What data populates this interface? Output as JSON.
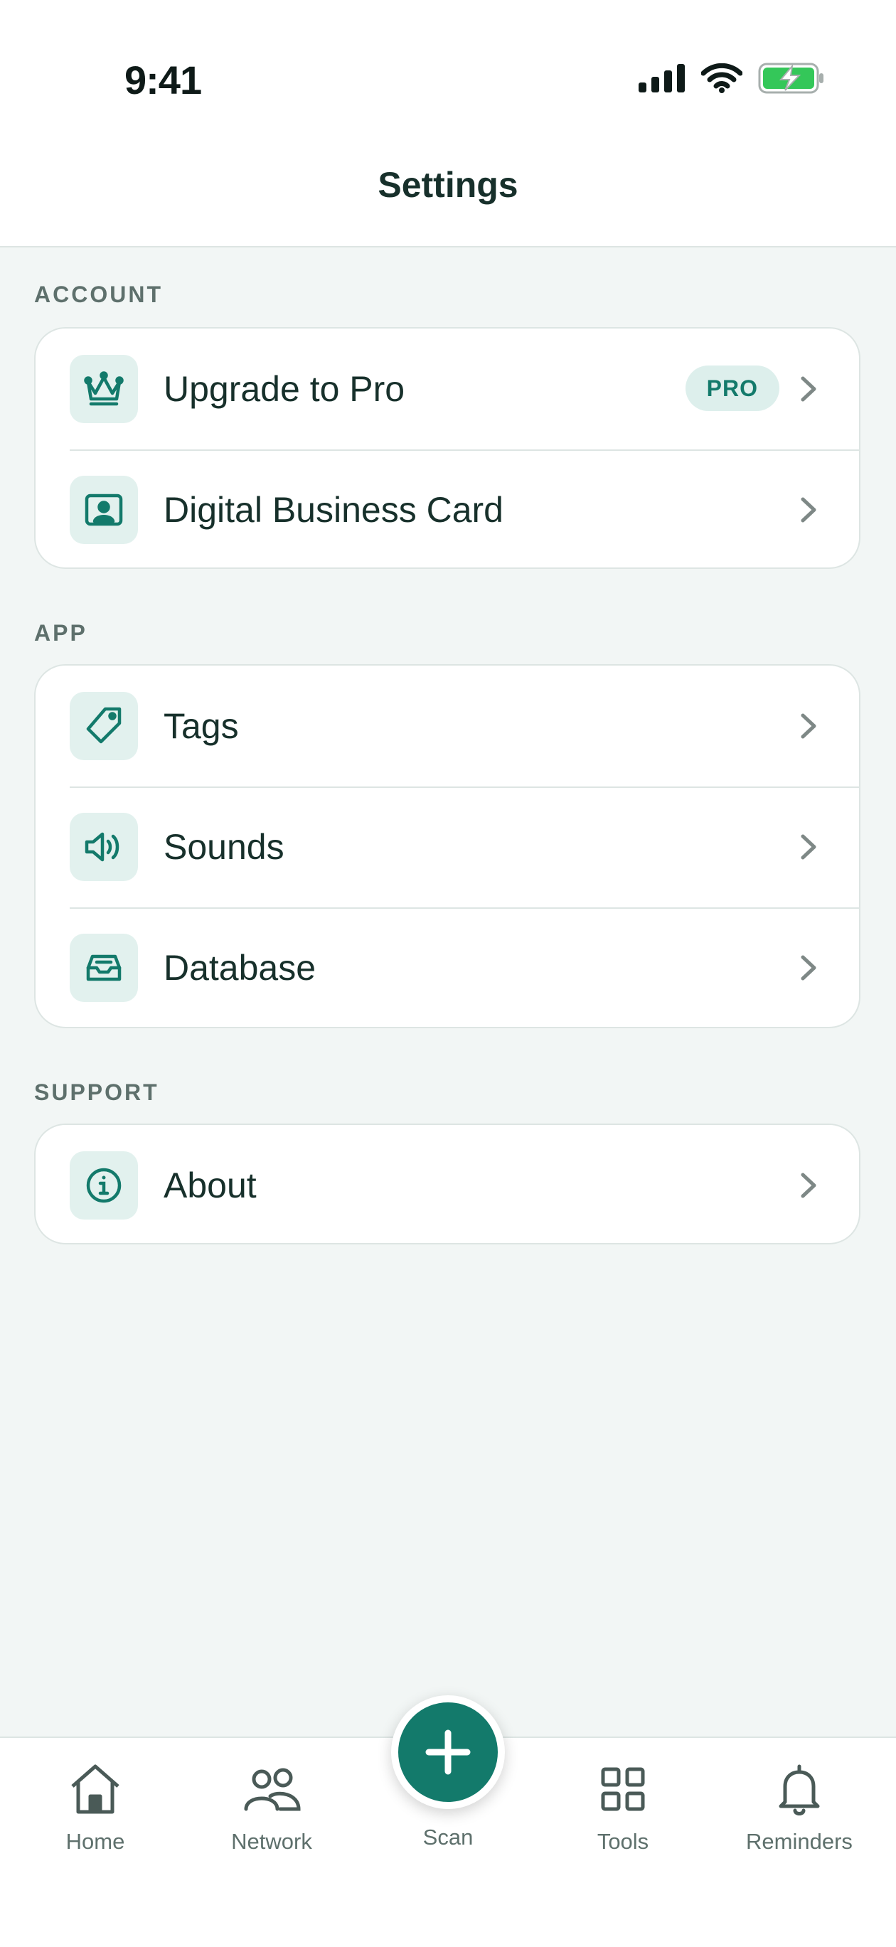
{
  "status": {
    "time": "9:41"
  },
  "header": {
    "title": "Settings"
  },
  "sections": {
    "account": {
      "title": "ACCOUNT",
      "items": [
        {
          "label": "Upgrade to Pro",
          "badge": "PRO",
          "icon": "crown-icon"
        },
        {
          "label": "Digital Business Card",
          "icon": "contact-card-icon"
        }
      ]
    },
    "app": {
      "title": "APP",
      "items": [
        {
          "label": "Tags",
          "icon": "tag-icon"
        },
        {
          "label": "Sounds",
          "icon": "speaker-icon"
        },
        {
          "label": "Database",
          "icon": "inbox-tray-icon"
        }
      ]
    },
    "support": {
      "title": "SUPPORT",
      "items": [
        {
          "label": "About",
          "icon": "info-icon"
        }
      ]
    }
  },
  "tabbar": {
    "items": [
      {
        "label": "Home",
        "icon": "home-icon"
      },
      {
        "label": "Network",
        "icon": "people-icon"
      },
      {
        "label": "Scan",
        "icon": "plus-icon"
      },
      {
        "label": "Tools",
        "icon": "grid-icon"
      },
      {
        "label": "Reminders",
        "icon": "bell-icon"
      }
    ]
  },
  "colors": {
    "accent": "#137A6B",
    "background": "#F2F6F5",
    "tile": "#E2F1EE",
    "text": "#17302B",
    "muted": "#5E706C",
    "battery": "#34C759"
  }
}
